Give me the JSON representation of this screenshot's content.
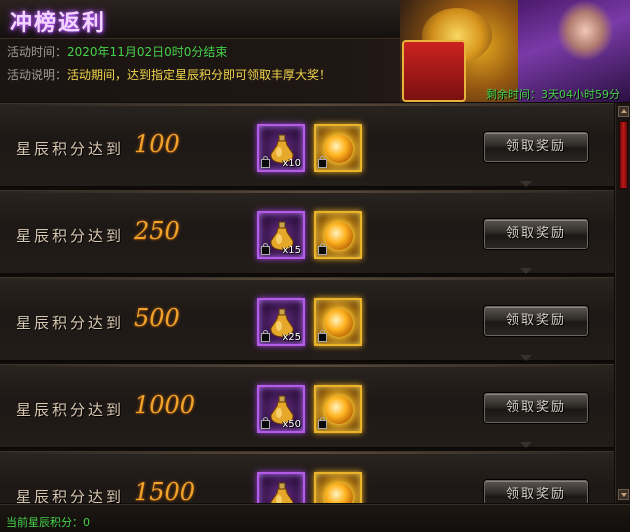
{
  "header": {
    "title": "冲榜返利",
    "time_label": "活动时间：",
    "time_value": "2020年11月02日0时0分结束",
    "desc_label": "活动说明：",
    "desc_value": "活动期间，达到指定星辰积分即可领取丰厚大奖！",
    "remaining": "剩余时间：3天04小时59分"
  },
  "rewards": [
    {
      "label": "星辰积分达到",
      "value": "100",
      "item_count": "x10",
      "button": "领取奖励"
    },
    {
      "label": "星辰积分达到",
      "value": "250",
      "item_count": "x15",
      "button": "领取奖励"
    },
    {
      "label": "星辰积分达到",
      "value": "500",
      "item_count": "x25",
      "button": "领取奖励"
    },
    {
      "label": "星辰积分达到",
      "value": "1000",
      "item_count": "x50",
      "button": "领取奖励"
    },
    {
      "label": "星辰积分达到",
      "value": "1500",
      "item_count": "",
      "button": "领取奖励"
    }
  ],
  "footer": {
    "current_points": "当前星辰积分：0"
  },
  "icons": {
    "item1": "potion-icon",
    "item2": "golden-orb-icon",
    "bound": "lock-icon"
  },
  "colors": {
    "accent_green": "#45d24a",
    "accent_gold": "#f0a22a",
    "title_purple": "#c26bff"
  }
}
